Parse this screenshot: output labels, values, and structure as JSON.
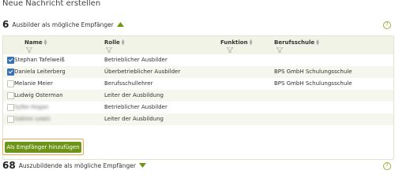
{
  "page": {
    "title": "Neue Nachricht erstellen"
  },
  "trainers": {
    "count": "6",
    "label": "Ausbilder als mögliche Empfänger",
    "help": "?",
    "columns": {
      "name": "Name",
      "role": "Rolle",
      "function": "Funktion",
      "school": "Berufsschule"
    },
    "rows": [
      {
        "name": "Stephan Tafelweiß",
        "role": "Betrieblicher Ausbilder",
        "function": "",
        "school": "",
        "checked": true,
        "blurred": false
      },
      {
        "name": "Daniela Leiterberg",
        "role": "Überbetrieblicher Ausbilder",
        "function": "",
        "school": "BPS GmbH Schulungsschule",
        "checked": true,
        "blurred": false
      },
      {
        "name": "Melanie Meier",
        "role": "Berufsschullehrer",
        "function": "",
        "school": "BPS GmbH Schulungsschule",
        "checked": false,
        "blurred": false
      },
      {
        "name": "Ludwig Osterman",
        "role": "Leiter der Ausbildung",
        "function": "",
        "school": "",
        "checked": false,
        "blurred": false
      },
      {
        "name": "Sylke Hogan",
        "role": "Betrieblicher Ausbilder",
        "function": "",
        "school": "",
        "checked": false,
        "blurred": true
      },
      {
        "name": "Sabine Lewis",
        "role": "Leiter der Ausbildung",
        "function": "",
        "school": "",
        "checked": false,
        "blurred": true
      }
    ],
    "add_button_label": "Als Empfänger hinzufügen"
  },
  "apprentices": {
    "count": "68",
    "label": "Auszubildende als mögliche Empfänger",
    "help": "?"
  },
  "colors": {
    "accent": "#6e9417",
    "highlight": "#f0a94a",
    "checkbox": "#3a72b7"
  }
}
